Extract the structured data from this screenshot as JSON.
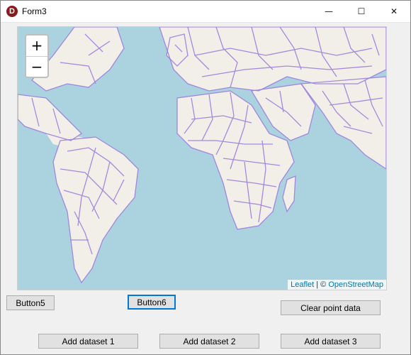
{
  "window": {
    "title": "Form3",
    "app_icon_letter": "D"
  },
  "title_buttons": {
    "minimize": "—",
    "maximize": "☐",
    "close": "✕"
  },
  "map": {
    "zoom_in": "+",
    "zoom_out": "−",
    "attribution": {
      "leaflet": "Leaflet",
      "separator": " | © ",
      "osm": "OpenStreetMap"
    },
    "colors": {
      "water": "#aad3df",
      "land": "#f2efe9",
      "boundary": "#9b7ddc"
    }
  },
  "buttons": {
    "button5": "Button5",
    "button6": "Button6",
    "clear_point_data": "Clear point data",
    "add_dataset_1": "Add dataset 1",
    "add_dataset_2": "Add dataset 2",
    "add_dataset_3": "Add dataset 3"
  }
}
